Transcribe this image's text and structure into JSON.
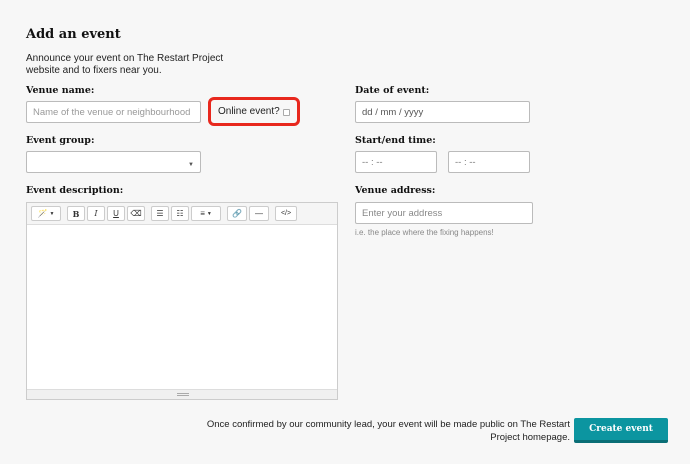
{
  "page": {
    "title": "Add an event",
    "intro": "Announce your event on The Restart Project website and to fixers near you."
  },
  "venue": {
    "label": "Venue name:",
    "placeholder": "Name of the venue or neighbourhood"
  },
  "online": {
    "label": "Online event?",
    "checked": false
  },
  "date": {
    "label": "Date of event:",
    "placeholder": "dd / mm / yyyy"
  },
  "group": {
    "label": "Event group:",
    "value": ""
  },
  "time": {
    "label": "Start/end time:",
    "start_placeholder": "-- : --",
    "end_placeholder": "-- : --"
  },
  "description": {
    "label": "Event description:",
    "toolbar": {
      "magic": "🪄",
      "bold": "B",
      "italic": "I",
      "underline": "U",
      "eraser": "⌫",
      "ul": "☰",
      "ol": "☷",
      "align": "≡",
      "link": "🔗",
      "hr": "—",
      "code": "</>"
    }
  },
  "address": {
    "label": "Venue address:",
    "placeholder": "Enter your address",
    "hint": "i.e. the place where the fixing happens!"
  },
  "footer": {
    "note": "Once confirmed by our community lead, your event will be made public on The Restart Project homepage.",
    "create_button": "Create event"
  },
  "colors": {
    "accent": "#0c95a0",
    "highlight": "#e8281e"
  }
}
